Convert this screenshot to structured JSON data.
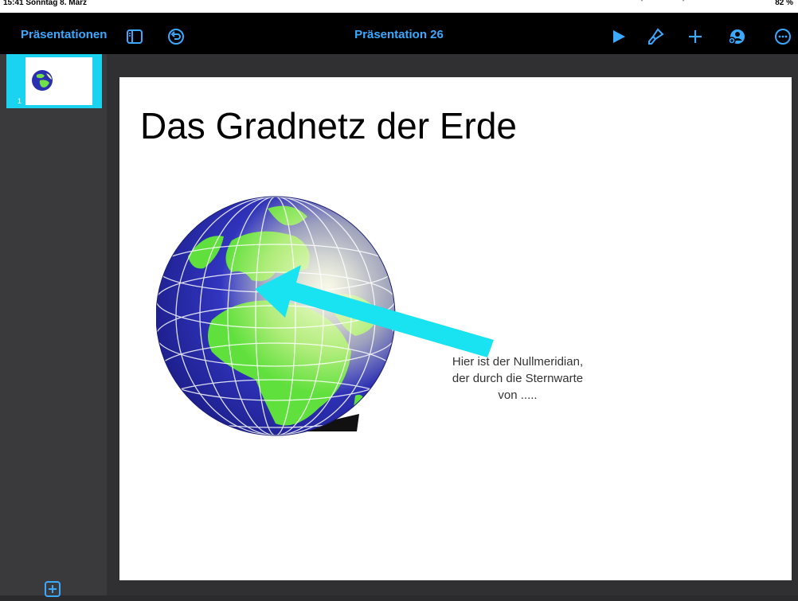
{
  "status_bar": {
    "time_date": "15:41  Sonntag 8. März",
    "battery": "82 %"
  },
  "toolbar": {
    "back_label": "Präsentationen",
    "document_title": "Präsentation 26",
    "icons": [
      "sidebar-icon",
      "undo-icon",
      "play-icon",
      "format-brush-icon",
      "plus-icon",
      "collaborate-icon",
      "more-icon"
    ],
    "accent_color": "#3aa9ff"
  },
  "sidebar": {
    "selected_slide_number": "1",
    "selection_color": "#19d3f0"
  },
  "slide": {
    "title": "Das Gradnetz der Erde",
    "caption_lines": [
      "Hier ist der Nullmeridian,",
      "der durch die Sternwarte",
      "von ....."
    ],
    "arrow_color": "#19e3f0"
  }
}
